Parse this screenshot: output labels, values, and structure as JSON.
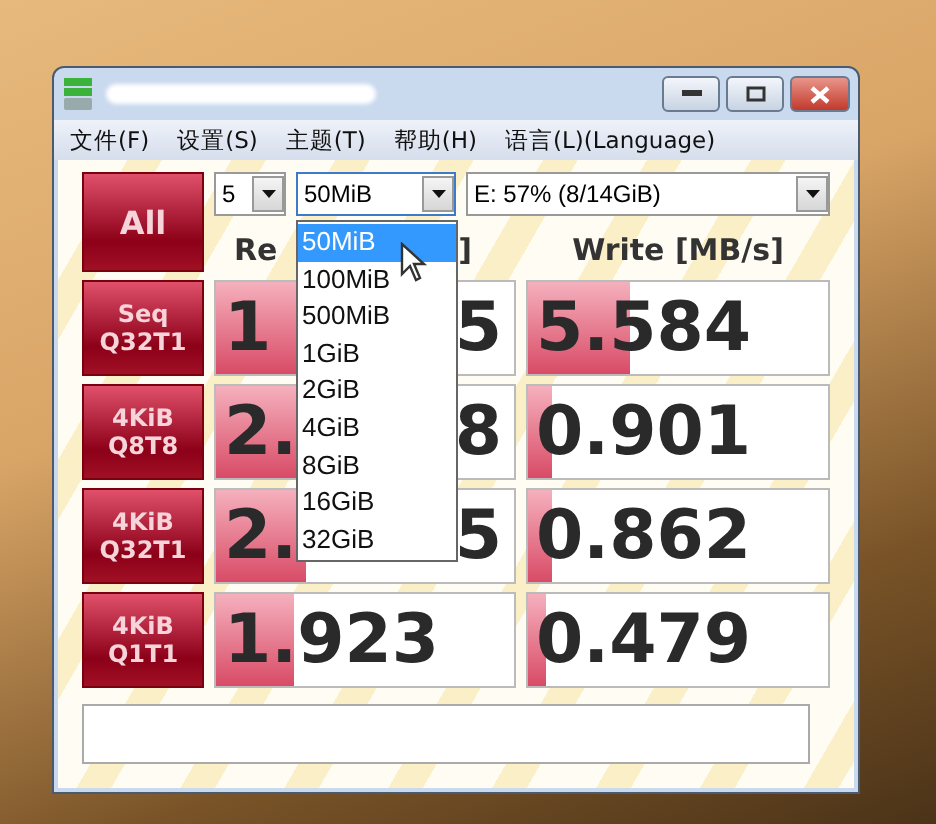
{
  "menu": [
    "文件(F)",
    "设置(S)",
    "主题(T)",
    "帮助(H)",
    "语言(L)(Language)"
  ],
  "all_button": "All",
  "count": {
    "value": "5"
  },
  "size": {
    "value": "50MiB",
    "expanded": true
  },
  "drive": {
    "value": "E: 57% (8/14GiB)"
  },
  "size_options": [
    {
      "label": "50MiB",
      "selected": true
    },
    {
      "label": "100MiB",
      "selected": false
    },
    {
      "label": "500MiB",
      "selected": false
    },
    {
      "label": "1GiB",
      "selected": false
    },
    {
      "label": "2GiB",
      "selected": false
    },
    {
      "label": "4GiB",
      "selected": false
    },
    {
      "label": "8GiB",
      "selected": false
    },
    {
      "label": "16GiB",
      "selected": false
    },
    {
      "label": "32GiB",
      "selected": false
    }
  ],
  "headers": {
    "read_start": "Re",
    "read_end": "]",
    "write": "Write [MB/s]"
  },
  "rows": [
    {
      "test": "Seq\nQ32T1",
      "read": {
        "start": "1",
        "end": "5",
        "level": 0.6
      },
      "write": {
        "value": "5.584",
        "level": 0.34
      }
    },
    {
      "test": "4KiB\nQ8T8",
      "read": {
        "start": "2.",
        "end": "8",
        "level": 0.3
      },
      "write": {
        "value": "0.901",
        "level": 0.08
      }
    },
    {
      "test": "4KiB\nQ32T1",
      "read": {
        "start": "2.",
        "end": "5",
        "level": 0.3
      },
      "write": {
        "value": "0.862",
        "level": 0.08
      }
    },
    {
      "test": "4KiB\nQ1T1",
      "read": {
        "start": "1.923",
        "level": 0.26
      },
      "write": {
        "value": "0.479",
        "level": 0.06
      }
    }
  ]
}
